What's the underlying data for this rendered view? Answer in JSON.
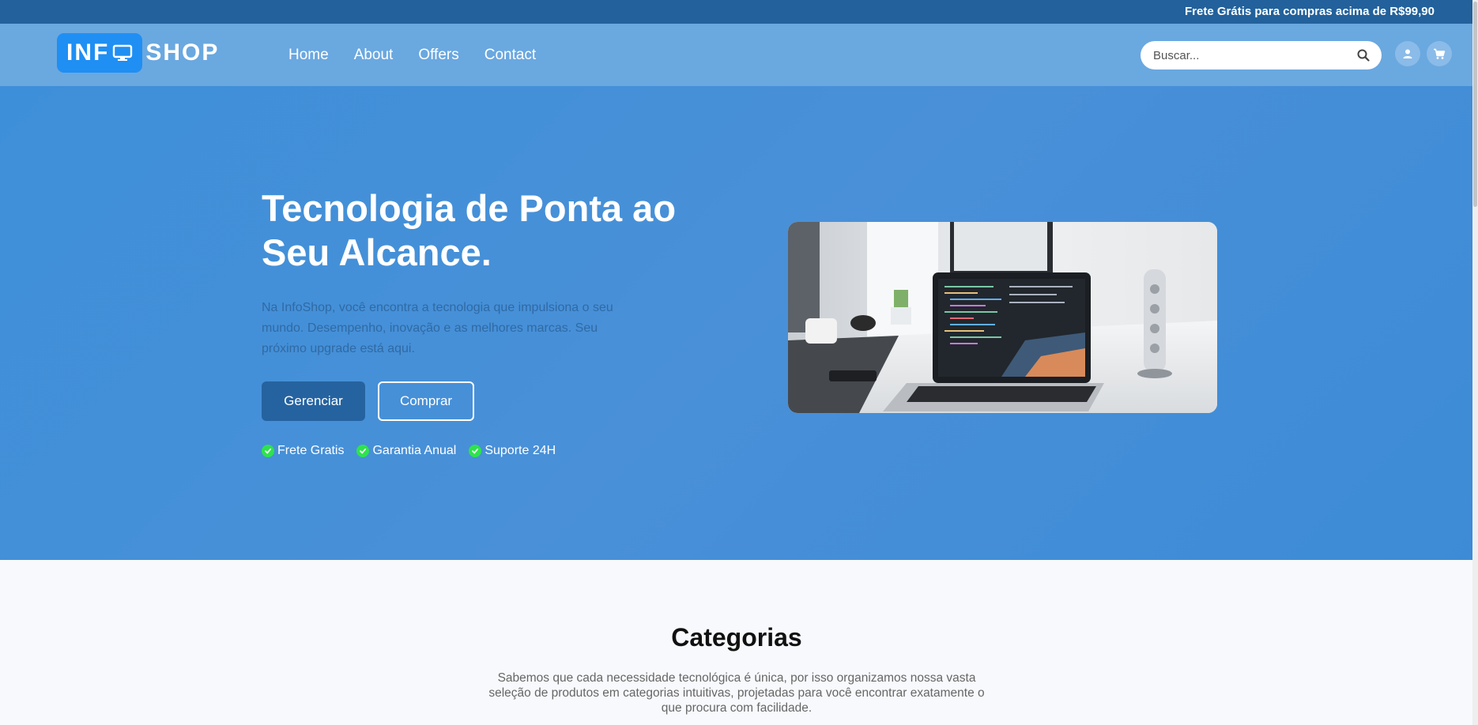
{
  "topbar": {
    "shipping_text": "Frete Grátis para compras acima de R$99,90"
  },
  "logo": {
    "part1": "INF",
    "part2": "SHOP"
  },
  "nav": {
    "items": [
      "Home",
      "About",
      "Offers",
      "Contact"
    ]
  },
  "search": {
    "placeholder": "Buscar...",
    "icon": "search-icon"
  },
  "header_icons": [
    "user-icon",
    "cart-icon"
  ],
  "hero": {
    "title": "Tecnologia de Ponta ao Seu Alcance.",
    "description": "Na InfoShop, você encontra a tecnologia que impulsiona o seu mundo. Desempenho, inovação e as melhores marcas. Seu próximo upgrade está aqui.",
    "buttons": {
      "primary": "Gerenciar",
      "secondary": "Comprar"
    },
    "features": [
      "Frete Gratis",
      "Garantia Anual",
      "Suporte 24H"
    ]
  },
  "categories": {
    "title": "Categorias",
    "description": "Sabemos que cada necessidade tecnológica é única, por isso organizamos nossa vasta seleção de produtos em categorias intuitivas, projetadas para você encontrar exatamente o que procura com facilidade."
  },
  "colors": {
    "topbar": "#22619b",
    "navbar": "#6aa8e0",
    "hero": "#3e8fd9",
    "primary_button": "#2563a0",
    "check": "#2ee34c",
    "logo_accent": "#1f8ff3"
  }
}
